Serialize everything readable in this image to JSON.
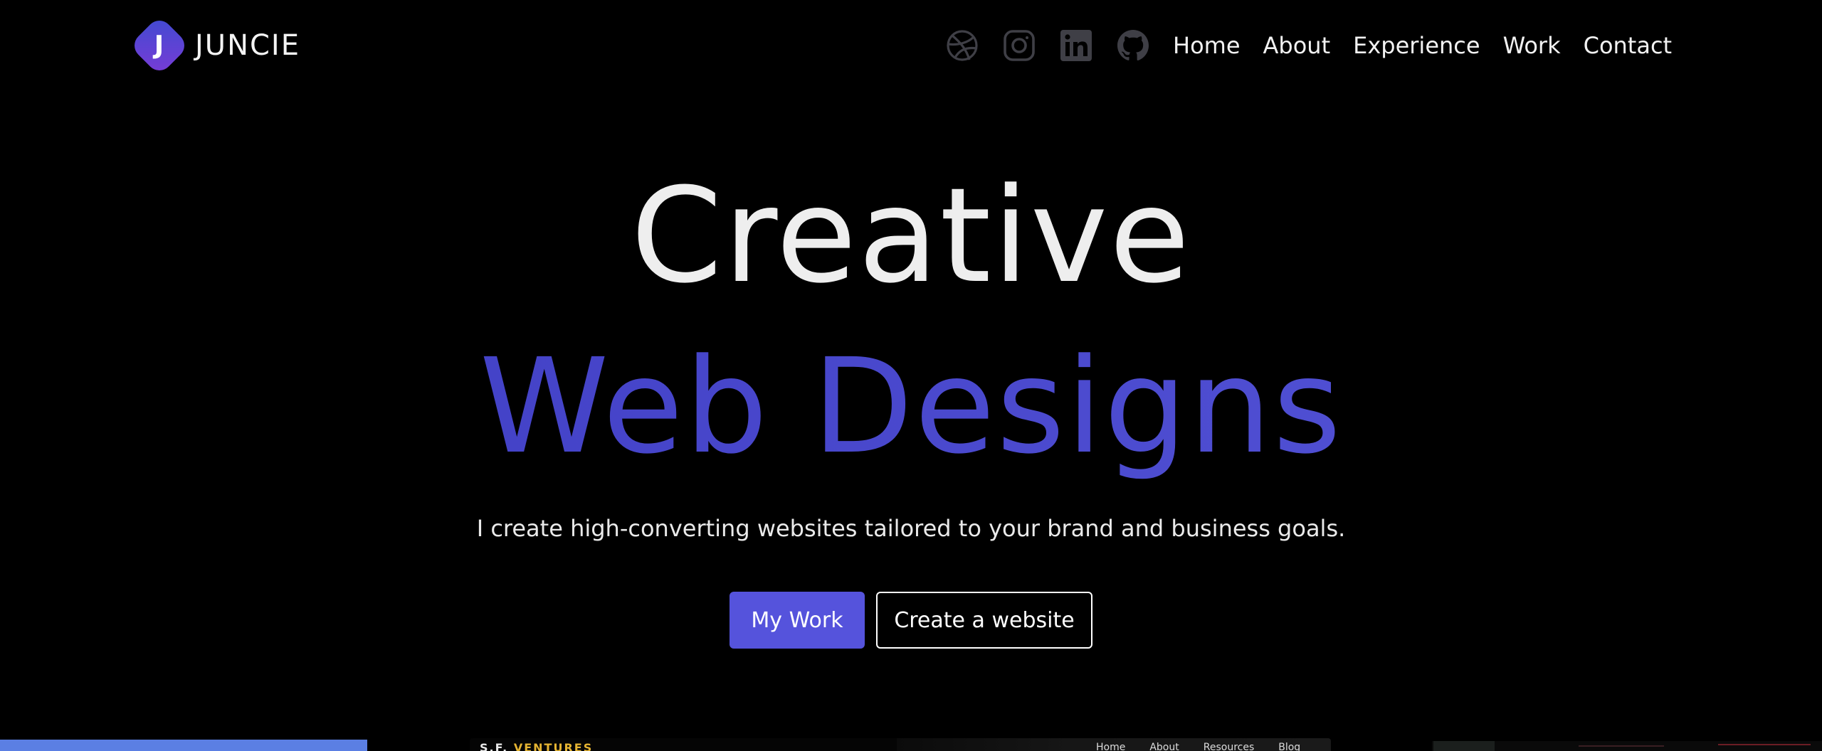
{
  "brand": {
    "logo_letter": "J",
    "name": "JUNCIE"
  },
  "social_links": [
    {
      "icon": "dribbble-icon"
    },
    {
      "icon": "instagram-icon"
    },
    {
      "icon": "linkedin-icon"
    },
    {
      "icon": "github-icon"
    }
  ],
  "nav": {
    "items": [
      {
        "label": "Home"
      },
      {
        "label": "About"
      },
      {
        "label": "Experience"
      },
      {
        "label": "Work"
      },
      {
        "label": "Contact"
      }
    ]
  },
  "hero": {
    "title_line1": "Creative",
    "title_line2": "Web Designs",
    "subtitle": "I create high-converting websites tailored to your brand and business goals.",
    "primary_button": "My Work",
    "secondary_button": "Create a website"
  },
  "preview": {
    "card_brand_first": "S.F.",
    "card_brand_second": "VENTURES",
    "card_nav": [
      "Home",
      "About",
      "Resources",
      "Blog"
    ]
  },
  "colors": {
    "background": "#000000",
    "accent": "#5553dc",
    "title_accent": "#4a47c9",
    "text": "#f1f1f1",
    "icon_muted": "#3f3f46"
  }
}
